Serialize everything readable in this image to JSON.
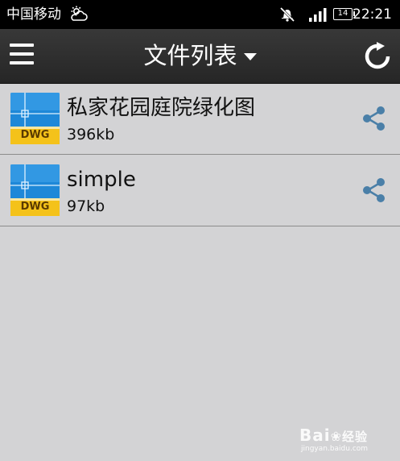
{
  "status_bar": {
    "carrier": "中国移动",
    "battery": "14",
    "time": "22:21",
    "icons": [
      "weather-cloud-icon",
      "mute-icon",
      "signal-icon",
      "battery-icon"
    ]
  },
  "action_bar": {
    "title": "文件列表",
    "icons": [
      "menu-icon",
      "dropdown-caret-icon",
      "refresh-icon"
    ]
  },
  "files": [
    {
      "name": "私家花园庭院绿化图",
      "size": "396kb",
      "badge": "DWG"
    },
    {
      "name": "simple",
      "size": "97kb",
      "badge": "DWG"
    }
  ],
  "watermark": {
    "brand": "Bai",
    "brand_suffix": "经验",
    "url": "jingyan.baidu.com"
  },
  "colors": {
    "status_bar_bg": "#000000",
    "action_bar_bg": "#2f2f2f",
    "list_bg": "#d3d3d5",
    "divider": "#8c8c8c",
    "dwg_blue": "#1e88d8",
    "dwg_yellow": "#f4c21a",
    "share_icon": "#4a7fa8"
  }
}
